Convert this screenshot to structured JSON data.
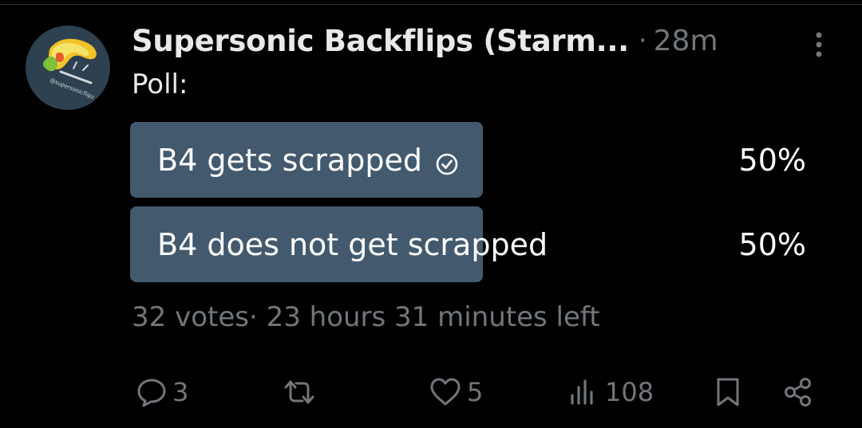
{
  "post": {
    "author_name": "Supersonic Backflips (Starm...",
    "separator": "·",
    "time_ago": "28m",
    "avatar_text": "@supersonicflipz",
    "poll_label": "Poll:"
  },
  "poll": {
    "options": [
      {
        "label": "B4 gets scrapped",
        "percent": "50%",
        "share": 0.5,
        "selected": true
      },
      {
        "label": "B4 does not get scrapped",
        "percent": "50%",
        "share": 0.5,
        "selected": false
      }
    ],
    "meta": "32 votes· 23 hours 31 minutes left"
  },
  "actions": {
    "replies": "3",
    "reposts": "",
    "likes": "5",
    "views": "108"
  },
  "colors": {
    "background": "#000000",
    "poll_bar": "#435a6e",
    "muted_text": "#71767b",
    "primary_text": "#e7e9ea"
  },
  "icons": [
    "more-vertical-icon",
    "check-circle-icon",
    "reply-icon",
    "repost-icon",
    "like-icon",
    "views-icon",
    "bookmark-icon",
    "share-icon"
  ]
}
